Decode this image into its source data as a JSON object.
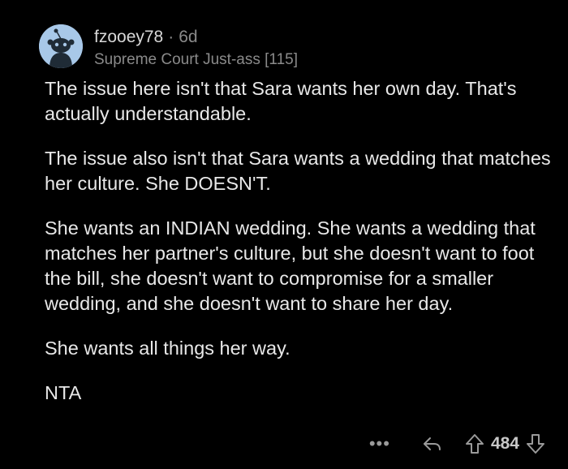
{
  "comment": {
    "username": "fzooey78",
    "separator": "·",
    "age": "6d",
    "flair": "Supreme Court Just-ass [115]",
    "paragraphs": [
      "The issue here isn't that Sara wants her own day. That's actually understandable.",
      "The issue also isn't that Sara wants a wedding that matches her culture. She DOESN'T.",
      "She wants an INDIAN wedding. She wants a wedding that matches her partner's culture, but she doesn't want to foot the bill, she doesn't want to compromise for a smaller wedding, and she doesn't want to share her day.",
      "She wants all things her way.",
      "NTA"
    ],
    "actions": {
      "more_label": "•••",
      "score": "484"
    },
    "icons": {
      "avatar": "snoo-avatar-icon",
      "more": "more-options-icon",
      "reply": "reply-arrow-icon",
      "upvote": "upvote-arrow-icon",
      "downvote": "downvote-arrow-icon"
    },
    "colors": {
      "background": "#000000",
      "text": "#e8e8e8",
      "muted": "#8a8a8a",
      "avatar_bg": "#a8c8e8"
    }
  }
}
